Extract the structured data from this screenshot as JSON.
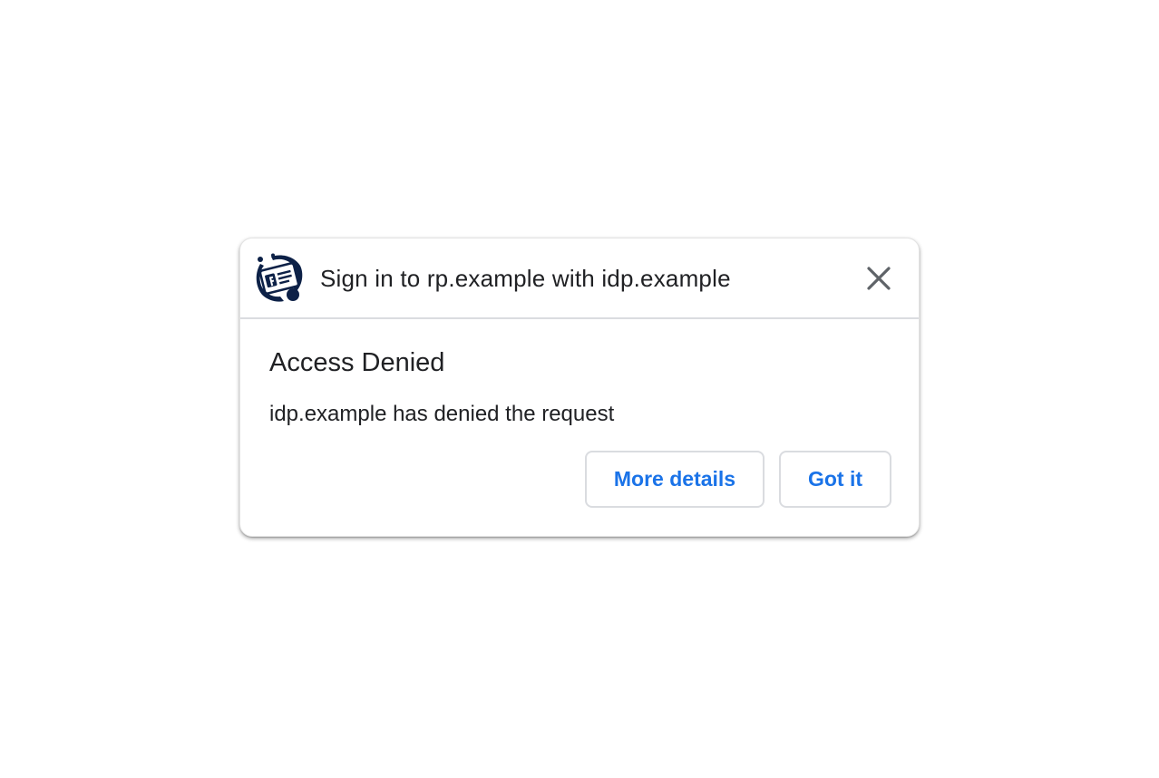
{
  "header": {
    "logo_icon": "idp-logo-icon",
    "title": "Sign in to rp.example with idp.example",
    "close_icon": "close-icon"
  },
  "content": {
    "title": "Access Denied",
    "message": "idp.example has denied the request"
  },
  "buttons": {
    "more_details_label": "More details",
    "got_it_label": "Got it"
  },
  "colors": {
    "accent": "#1a73e8",
    "text": "#202124",
    "logo": "#0d2147",
    "border": "#dadce0",
    "close_icon": "#5f6368"
  }
}
